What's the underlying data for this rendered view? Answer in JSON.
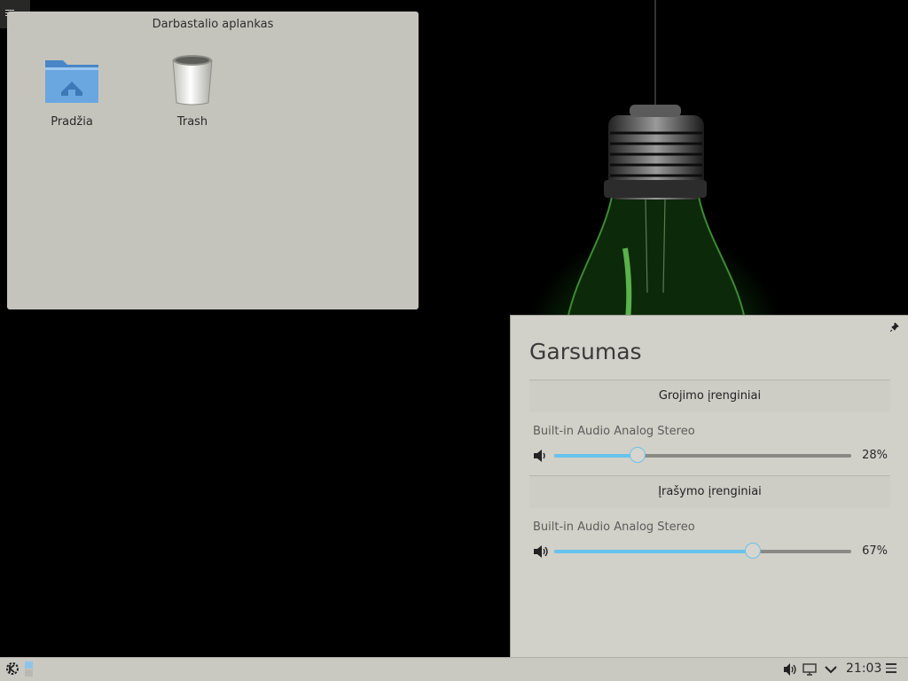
{
  "desktop": {
    "folder_view": {
      "title": "Darbastalio aplankas",
      "icons": [
        {
          "label": "Pradžia",
          "icon": "home-folder-icon"
        },
        {
          "label": "Trash",
          "icon": "trash-icon"
        }
      ]
    }
  },
  "volume_applet": {
    "title": "Garsumas",
    "playback": {
      "header": "Grojimo įrenginiai",
      "device": "Built-in Audio Analog Stereo",
      "volume_percent": 28,
      "volume_label": "28%"
    },
    "recording": {
      "header": "Įrašymo įrenginiai",
      "device": "Built-in Audio Analog Stereo",
      "volume_percent": 67,
      "volume_label": "67%"
    }
  },
  "panel": {
    "clock": "21:03",
    "tray_icons": [
      "volume-icon",
      "display-icon",
      "expand-arrow-icon"
    ]
  },
  "colors": {
    "accent": "#67c3ee",
    "panel_bg": "#c9c8c1",
    "popup_bg": "#d1d0c9",
    "folder_view_bg": "#c5c4bc"
  }
}
